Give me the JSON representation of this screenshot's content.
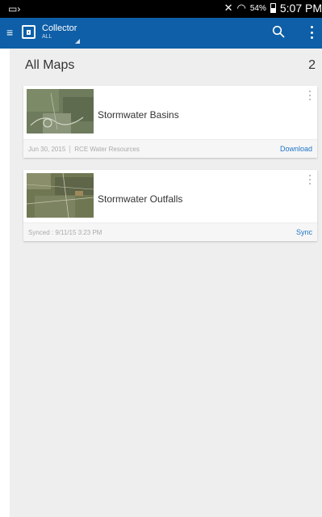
{
  "status_bar": {
    "battery_percent": "54%",
    "time": "5:07 PM",
    "colors": {
      "background": "#000000",
      "text": "#ffffff"
    }
  },
  "app_bar": {
    "title": "Collector",
    "subtitle": "ALL",
    "icons": [
      "menu-icon",
      "collector-logo-icon",
      "dropdown-triangle-icon",
      "search-icon",
      "overflow-menu-icon"
    ],
    "color": "#0e5fa7"
  },
  "main": {
    "section_title": "All Maps",
    "count": "2",
    "background": "#eeeeee",
    "maps": [
      {
        "name": "Stormwater Basins",
        "date": "Jun 30, 2015",
        "owner": "RCE Water Resources",
        "action": "Download"
      },
      {
        "name": "Stormwater Outfalls",
        "synced": "Synced : 9/11/15 3:23 PM",
        "action": "Sync"
      }
    ],
    "accent": "#1e75c6"
  }
}
